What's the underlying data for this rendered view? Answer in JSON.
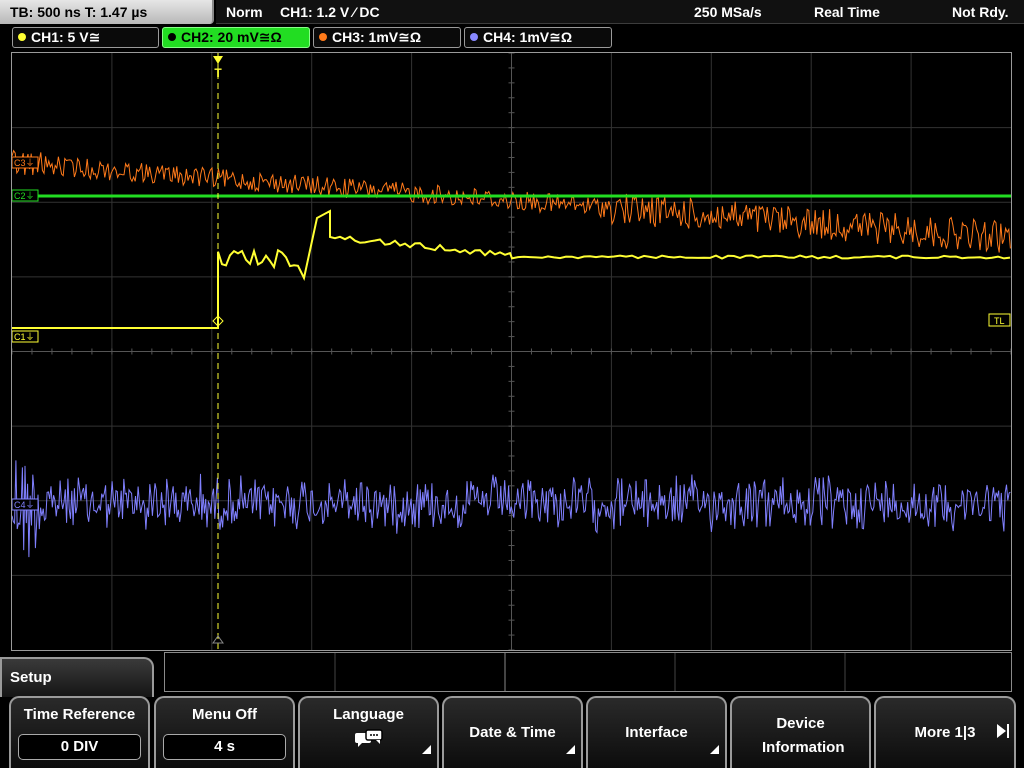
{
  "status": {
    "timebase": "TB: 500 ns   T: 1.47 µs",
    "trigger_mode": "Norm",
    "trigger_source": "CH1: 1.2 V ⁄ DC",
    "sample_rate": "250 MSa/s",
    "acq_mode": "Real Time",
    "state": "Not Rdy."
  },
  "channels": [
    {
      "label": "CH1: 5 V≅",
      "color": "#ffff33",
      "active": false
    },
    {
      "label": "CH2: 20 mV≅Ω",
      "color": "#22dd22",
      "active": true
    },
    {
      "label": "CH3: 1mV≅Ω",
      "color": "#ff7a1a",
      "active": false
    },
    {
      "label": "CH4: 1mV≅Ω",
      "color": "#8888ff",
      "active": false
    }
  ],
  "markers": {
    "ch1": "C1",
    "ch2": "C2",
    "ch3": "C3",
    "ch4": "C4",
    "trigger_level": "TL",
    "trigger_pos": "T"
  },
  "menu": {
    "title": "Setup",
    "softkeys": [
      {
        "label": "Time Reference",
        "value": "0 DIV"
      },
      {
        "label": "Menu Off",
        "value": "4 s"
      },
      {
        "label": "Language",
        "icon": "speech-bubbles-icon"
      },
      {
        "label": "Date & Time"
      },
      {
        "label": "Interface"
      },
      {
        "label": "Device Information"
      },
      {
        "label": "More 1|3"
      }
    ]
  }
}
